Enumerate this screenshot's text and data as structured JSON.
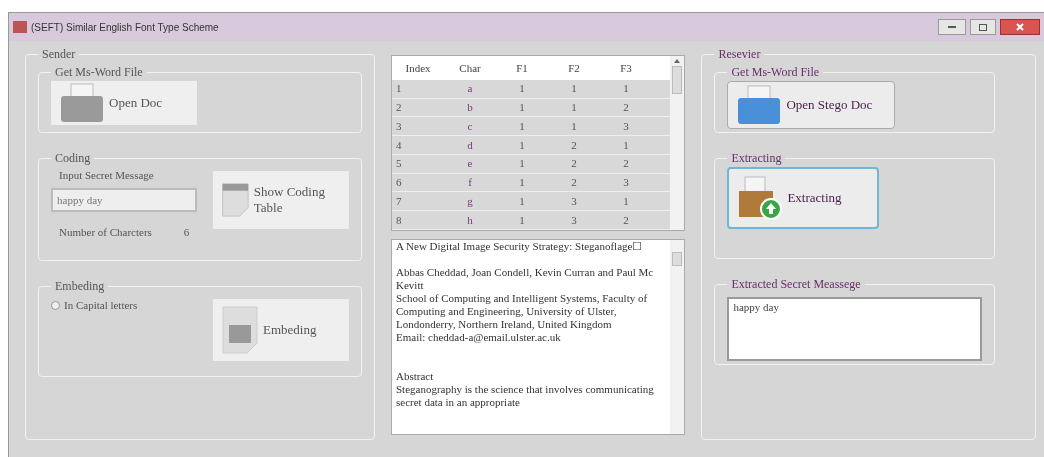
{
  "window": {
    "title": "(SEFT) Similar English Font Type Scheme"
  },
  "sender": {
    "title": "Sender",
    "get_file": {
      "title": "Get Ms-Word File",
      "button": "Open Doc"
    },
    "coding": {
      "title": "Coding",
      "input_label": "Input Secret Message",
      "input_value": "happy day",
      "button": "Show Coding Table",
      "count_label": "Number of Charcters",
      "count": "6"
    },
    "embeding": {
      "title": "Embeding",
      "radio": {
        "label": "In Capital letters",
        "selected": false
      },
      "button": "Embeding"
    }
  },
  "table": {
    "columns": [
      "Index",
      "Char",
      "F1",
      "F2",
      "F3"
    ],
    "rows": [
      {
        "cells": [
          "1",
          "a",
          "1",
          "1",
          "1"
        ]
      },
      {
        "cells": [
          "2",
          "b",
          "1",
          "1",
          "2"
        ]
      },
      {
        "cells": [
          "3",
          "c",
          "1",
          "1",
          "3"
        ]
      },
      {
        "cells": [
          "4",
          "d",
          "1",
          "2",
          "1"
        ]
      },
      {
        "cells": [
          "5",
          "e",
          "1",
          "2",
          "2"
        ]
      },
      {
        "cells": [
          "6",
          "f",
          "1",
          "2",
          "3"
        ]
      },
      {
        "cells": [
          "7",
          "g",
          "1",
          "3",
          "1"
        ]
      },
      {
        "cells": [
          "8",
          "h",
          "1",
          "3",
          "2"
        ]
      }
    ]
  },
  "document": {
    "paragraphs": [
      "A New Digital Image Security Strategy: Steganoflage☐",
      "Abbas Cheddad, Joan Condell, Kevin Curran and Paul Mc Kevitt\nSchool of Computing and Intelligent Systems, Faculty of Computing and Engineering, University of Ulster, Londonderry, Northern Ireland, United Kingdom\nEmail: cheddad-a@email.ulster.ac.uk",
      "Abstract\nSteganography is the science that involves communicating secret data in an appropriate"
    ]
  },
  "receiver": {
    "title": "Resevier",
    "get_file": {
      "title": "Get Ms-Word File",
      "button": "Open Stego Doc"
    },
    "extracting": {
      "title": "Extracting",
      "button": "Extracting"
    },
    "extracted": {
      "title": "Extracted Secret Meassege",
      "value": "happy day"
    }
  }
}
